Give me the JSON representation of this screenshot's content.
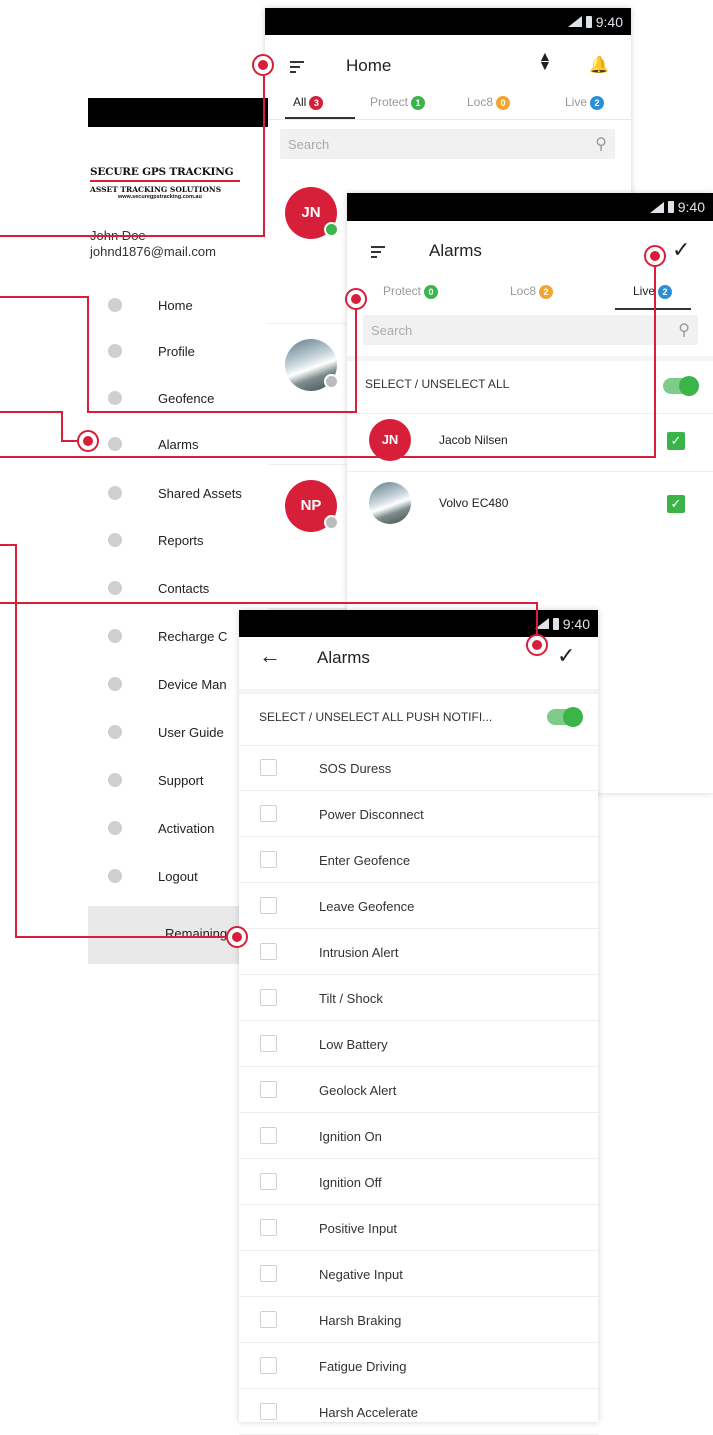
{
  "status_time": "9:40",
  "home": {
    "title": "Home",
    "tabs": [
      {
        "label": "All",
        "count": "3",
        "color": "#d81f3a"
      },
      {
        "label": "Protect",
        "count": "1",
        "color": "#3bb54a"
      },
      {
        "label": "Loc8",
        "count": "0",
        "color": "#f2a632"
      },
      {
        "label": "Live",
        "count": "2",
        "color": "#2a8fd8"
      }
    ],
    "search_placeholder": "Search",
    "list": [
      {
        "initials": "JN"
      },
      {
        "initials": ""
      },
      {
        "initials": "NP"
      }
    ]
  },
  "drawer": {
    "brand_title": "SECURE GPS TRACKING",
    "brand_subtitle": "ASSET TRACKING SOLUTIONS",
    "brand_url": "www.securegpstracking.com.au",
    "user_name": "John Doe",
    "user_email": "johnd1876@mail.com",
    "items": [
      {
        "label": "Home",
        "icon": "home-icon"
      },
      {
        "label": "Profile",
        "icon": "gear-icon"
      },
      {
        "label": "Geofence",
        "icon": "geofence-icon"
      },
      {
        "label": "Alarms",
        "icon": "alarm-icon"
      },
      {
        "label": "Shared Assets",
        "icon": "share-icon"
      },
      {
        "label": "Reports",
        "icon": "reports-icon"
      },
      {
        "label": "Contacts",
        "icon": "contacts-icon"
      },
      {
        "label": "Recharge C",
        "icon": "card-icon"
      },
      {
        "label": "Device Man",
        "icon": "device-icon"
      },
      {
        "label": "User Guide",
        "icon": "guide-icon"
      },
      {
        "label": "Support",
        "icon": "support-icon"
      },
      {
        "label": "Activation",
        "icon": "activation-icon"
      },
      {
        "label": "Logout",
        "icon": "power-icon"
      }
    ],
    "footer_label": "Remaining"
  },
  "alarms_select": {
    "title": "Alarms",
    "tabs": [
      {
        "label": "Protect",
        "count": "0",
        "color": "#3bb54a"
      },
      {
        "label": "Loc8",
        "count": "2",
        "color": "#f2a632"
      },
      {
        "label": "Live",
        "count": "2",
        "color": "#2a8fd8"
      }
    ],
    "search_placeholder": "Search",
    "select_all_label": "SELECT / UNSELECT ALL",
    "devices": [
      {
        "initials": "JN",
        "name": "Jacob Nilsen"
      },
      {
        "initials": "",
        "name": "Volvo EC480"
      }
    ]
  },
  "alarms_notifications": {
    "title": "Alarms",
    "select_all_label": "SELECT / UNSELECT ALL PUSH NOTIFI...",
    "items": [
      "SOS Duress",
      "Power Disconnect",
      "Enter Geofence",
      "Leave Geofence",
      "Intrusion Alert",
      "Tilt / Shock",
      "Low Battery",
      "Geolock Alert",
      "Ignition On",
      "Ignition Off",
      "Positive Input",
      "Negative Input",
      "Harsh Braking",
      "Fatigue Driving",
      "Harsh Accelerate"
    ]
  }
}
